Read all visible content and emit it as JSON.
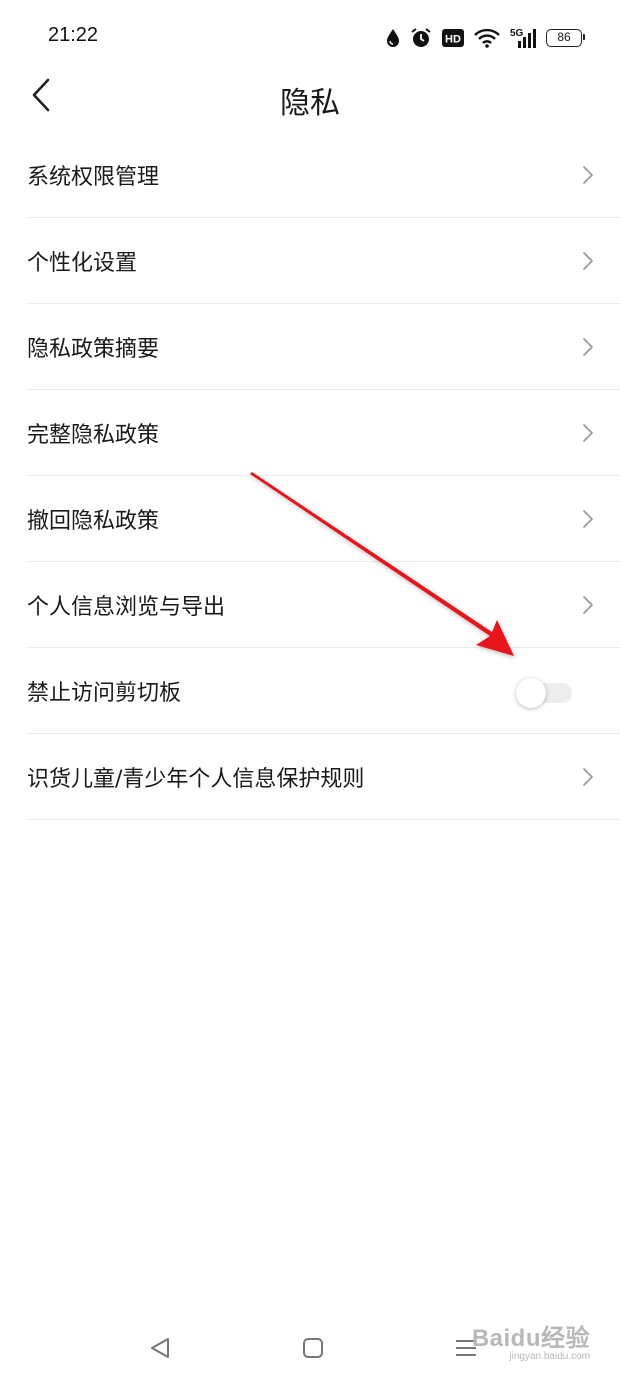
{
  "status_bar": {
    "time": "21:22",
    "icons": [
      "drop-icon",
      "alarm-icon",
      "hd-icon",
      "wifi-icon",
      "signal-5g-icon",
      "battery-icon"
    ],
    "network_label": "5G",
    "hd_label": "HD",
    "battery_level": "86"
  },
  "header": {
    "title": "隐私",
    "back_icon": "chevron-left-icon"
  },
  "settings": {
    "items": [
      {
        "label": "系统权限管理",
        "control": "chevron"
      },
      {
        "label": "个性化设置",
        "control": "chevron"
      },
      {
        "label": "隐私政策摘要",
        "control": "chevron"
      },
      {
        "label": "完整隐私政策",
        "control": "chevron"
      },
      {
        "label": "撤回隐私政策",
        "control": "chevron"
      },
      {
        "label": "个人信息浏览与导出",
        "control": "chevron"
      },
      {
        "label": "禁止访问剪切板",
        "control": "toggle",
        "toggle_on": false
      },
      {
        "label": "识货儿童/青少年个人信息保护规则",
        "control": "chevron"
      }
    ]
  },
  "annotation": {
    "type": "arrow",
    "color": "#e8141c",
    "points_to": "禁止访问剪切板 toggle"
  },
  "system_nav": {
    "buttons": [
      "back-triangle-icon",
      "home-square-icon",
      "menu-lines-icon"
    ]
  },
  "watermark": {
    "main": "Baidu经验",
    "sub": "jingyan.baidu.com"
  },
  "colors": {
    "background": "#ffffff",
    "text": "#1a1a1a",
    "divider": "#ececec",
    "chevron": "#9a9a9a",
    "toggle_track": "#ededed"
  }
}
